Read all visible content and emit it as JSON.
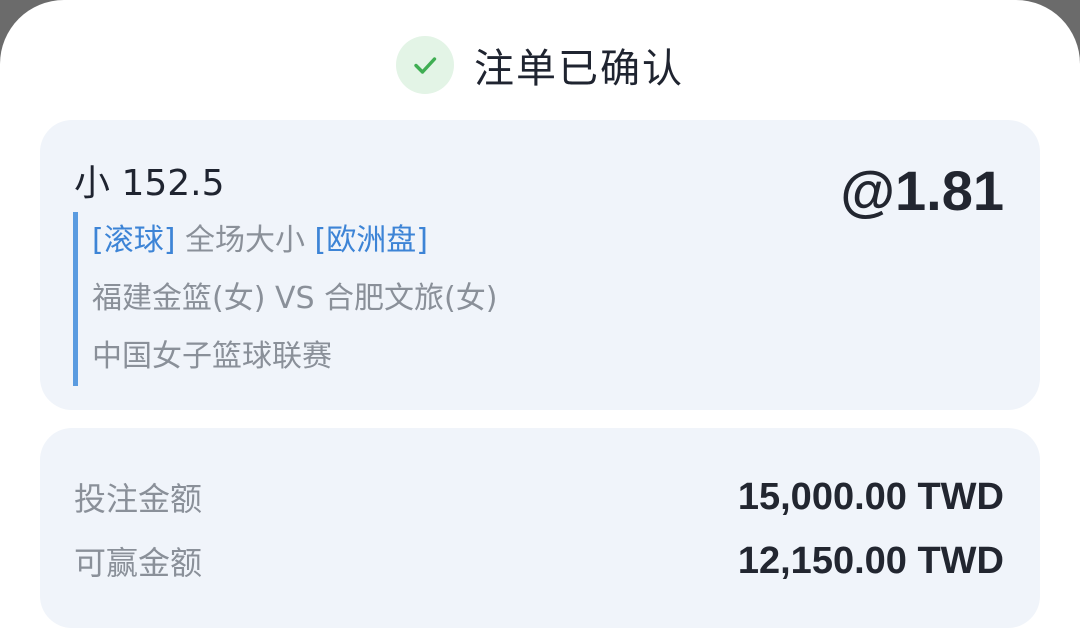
{
  "header": {
    "icon": "check-icon",
    "title": "注单已确认",
    "accent_color": "#3fae53"
  },
  "bet": {
    "selection": "小 152.5",
    "odds": "@1.81",
    "tag_live": "[滚球]",
    "market": "全场大小",
    "tag_odds_type": "[欧洲盘]",
    "match": "福建金篮(女) VS 合肥文旅(女)",
    "league": "中国女子篮球联赛",
    "border_color": "#5a9be0"
  },
  "amounts": {
    "stake_label": "投注金额",
    "stake_value": "15,000.00 TWD",
    "win_label": "可赢金额",
    "win_value": "12,150.00 TWD"
  }
}
